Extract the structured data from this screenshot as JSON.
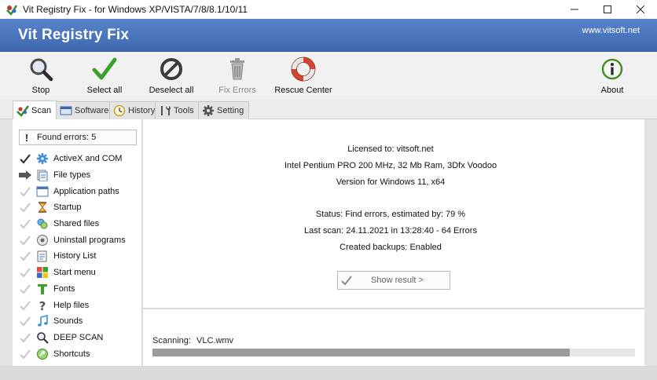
{
  "window": {
    "title": "Vit Registry Fix - for Windows XP/VISTA/7/8/8.1/10/11"
  },
  "banner": {
    "app_name": "Vit Registry Fix",
    "website": "www.vitsoft.net"
  },
  "toolbar": {
    "stop": "Stop",
    "select_all": "Select all",
    "deselect_all": "Deselect all",
    "fix_errors": "Fix Errors",
    "rescue_center": "Rescue Center",
    "about": "About"
  },
  "tabs": [
    "Scan",
    "Software",
    "History",
    "Tools",
    "Setting"
  ],
  "sidebar": {
    "found_errors": "Found errors: 5",
    "items": [
      {
        "label": "ActiveX and COM",
        "state": "done",
        "icon": "gear-icon"
      },
      {
        "label": "File types",
        "state": "current",
        "icon": "file-types-icon"
      },
      {
        "label": "Application paths",
        "state": "pending",
        "icon": "window-icon"
      },
      {
        "label": "Startup",
        "state": "pending",
        "icon": "hourglass-icon"
      },
      {
        "label": "Shared files",
        "state": "pending",
        "icon": "shared-files-icon"
      },
      {
        "label": "Uninstall programs",
        "state": "pending",
        "icon": "uninstall-icon"
      },
      {
        "label": "History List",
        "state": "pending",
        "icon": "history-list-icon"
      },
      {
        "label": "Start menu",
        "state": "pending",
        "icon": "windows-logo-icon"
      },
      {
        "label": "Fonts",
        "state": "pending",
        "icon": "font-icon"
      },
      {
        "label": "Help files",
        "state": "pending",
        "icon": "question-icon"
      },
      {
        "label": "Sounds",
        "state": "pending",
        "icon": "music-note-icon"
      },
      {
        "label": "DEEP SCAN",
        "state": "pending",
        "icon": "magnifier-icon"
      },
      {
        "label": "Shortcuts",
        "state": "pending",
        "icon": "shortcut-icon"
      }
    ]
  },
  "main": {
    "licensed": "Licensed to: vitsoft.net",
    "hardware": "Intel Pentium PRO 200 MHz, 32 Mb Ram, 3Dfx Voodoo",
    "version": "Version for Windows 11, x64",
    "status": "Status: Find errors, estimated by: 79 %",
    "last_scan": "Last scan: 24.11.2021 in 13:28:40 - 64 Errors",
    "backups": "Created backups: Enabled",
    "show_result": "Show result >"
  },
  "scan": {
    "label": "Scanning:",
    "file": "VLC.wmv",
    "progress": 0.865
  },
  "colors": {
    "banner": "#4a74bc",
    "progress_fill": "#9c9c9c"
  }
}
